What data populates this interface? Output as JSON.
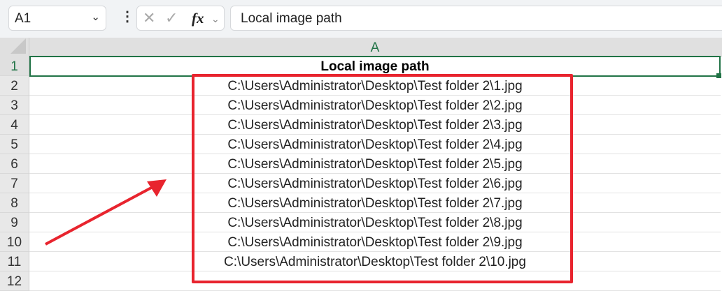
{
  "formula_bar": {
    "name_box": "A1",
    "formula": "Local image path",
    "fx_label": "fx"
  },
  "sheet": {
    "column_header": "A",
    "row_numbers": [
      "1",
      "2",
      "3",
      "4",
      "5",
      "6",
      "7",
      "8",
      "9",
      "10",
      "11",
      "12"
    ],
    "cells": [
      "Local image path",
      "C:\\Users\\Administrator\\Desktop\\Test folder 2\\1.jpg",
      "C:\\Users\\Administrator\\Desktop\\Test folder 2\\2.jpg",
      "C:\\Users\\Administrator\\Desktop\\Test folder 2\\3.jpg",
      "C:\\Users\\Administrator\\Desktop\\Test folder 2\\4.jpg",
      "C:\\Users\\Administrator\\Desktop\\Test folder 2\\5.jpg",
      "C:\\Users\\Administrator\\Desktop\\Test folder 2\\6.jpg",
      "C:\\Users\\Administrator\\Desktop\\Test folder 2\\7.jpg",
      "C:\\Users\\Administrator\\Desktop\\Test folder 2\\8.jpg",
      "C:\\Users\\Administrator\\Desktop\\Test folder 2\\9.jpg",
      "C:\\Users\\Administrator\\Desktop\\Test folder 2\\10.jpg",
      ""
    ]
  },
  "colors": {
    "accent": "#217346",
    "annotation": "#e8242e"
  }
}
